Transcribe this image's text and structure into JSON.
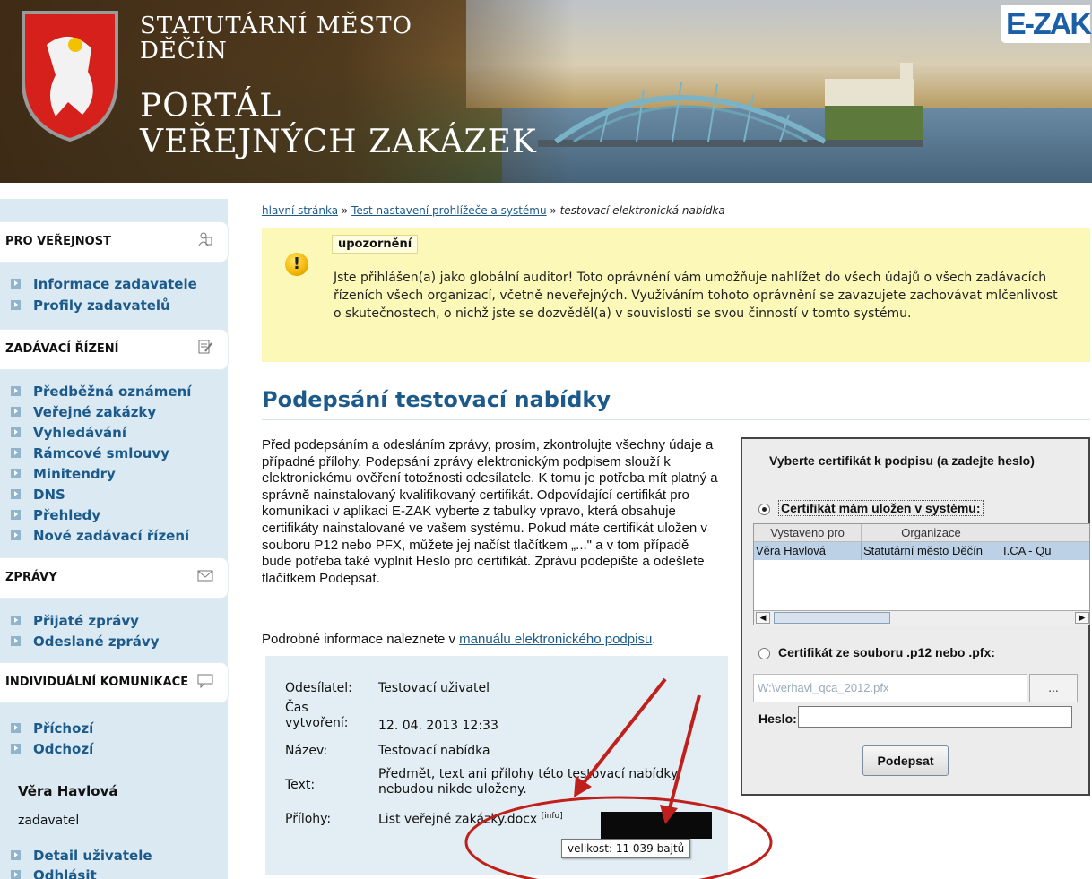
{
  "header": {
    "city_line1": "STATUTÁRNÍ MĚSTO",
    "city_line2": "DĚČÍN",
    "portal_line1": "PORTÁL",
    "portal_line2": "VEŘEJNÝCH ZAKÁZEK",
    "logo": "E-ZAK",
    "brand_color": "#1b5fa6"
  },
  "sidebar": {
    "sections": [
      {
        "label": "PRO VEŘEJNOST",
        "icon": "people-icon",
        "items": [
          "Informace zadavatele",
          "Profily zadavatelů"
        ]
      },
      {
        "label": "ZADÁVACÍ ŘÍZENÍ",
        "icon": "edit-document-icon",
        "items": [
          "Předběžná oznámení",
          "Veřejné zakázky",
          "Vyhledávání",
          "Rámcové smlouvy",
          "Minitendry",
          "DNS",
          "Přehledy",
          "Nové zadávací řízení"
        ]
      },
      {
        "label": "ZPRÁVY",
        "icon": "envelope-icon",
        "items": [
          "Přijaté zprávy",
          "Odeslané zprávy"
        ]
      },
      {
        "label": "INDIVIDUÁLNÍ KOMUNIKACE",
        "icon": "speech-bubble-icon",
        "items": [
          "Příchozí",
          "Odchozí"
        ]
      }
    ],
    "user": {
      "name": "Věra Havlová",
      "role": "zadavatel",
      "links": [
        "Detail uživatele",
        "Odhlásit"
      ]
    }
  },
  "breadcrumb": {
    "home": "hlavní stránka",
    "sep": "»",
    "level2": "Test nastavení prohlížeče a systému",
    "current": "testovací elektronická nabídka"
  },
  "warning": {
    "tag": "upozornění",
    "icon": "exclamation-icon",
    "text": "Jste přihlášen(a) jako globální auditor! Toto oprávnění vám umožňuje nahlížet do všech údajů o všech zadávacích řízeních všech organizací, včetně neveřejných. Využíváním tohoto oprávnění se zavazujete zachovávat mlčenlivost o skutečnostech, o nichž jste se dozvěděl(a) v souvislosti se svou činností v tomto systému."
  },
  "main": {
    "title": "Podepsání testovací nabídky",
    "description": "Před podepsáním a odesláním zprávy, prosím, zkontrolujte všechny údaje a případné přílohy. Podepsání zprávy elektronickým podpisem slouží k elektronickému ověření totožnosti odesílatele. K tomu je potřeba mít platný a správně nainstalovaný kvalifikovaný certifikát. Odpovídající certifikát pro komunikaci v aplikaci E-ZAK vyberte z tabulky vpravo, která obsahuje certifikáty nainstalované ve vašem systému. Pokud máte certifikát uložen v souboru P12 nebo PFX, můžete jej načíst tlačítkem „...\" a v tom případě bude potřeba také vyplnit Heslo pro certifikát. Zprávu podepište a odešlete tlačítkem Podepsat.",
    "more_prefix": "Podrobné informace naleznete v ",
    "more_link": "manuálu elektronického podpisu",
    "more_suffix": "."
  },
  "details": {
    "sender_label": "Odesílatel:",
    "sender_value": "Testovací uživatel",
    "created_label": "Čas vytvoření:",
    "created_value": "12. 04. 2013 12:33",
    "name_label": "Název:",
    "name_value": "Testovací nabídka",
    "text_label": "Text:",
    "text_value": "Předmět, text ani přílohy této testovací nabídky nebudou nikde uloženy.",
    "attach_label": "Přílohy:",
    "attach_value": "List veřejné zakázky.docx",
    "attach_info": "[info]",
    "tooltip": "velikost: 11 039 bajtů"
  },
  "applet": {
    "title": "Vyberte certifikát k podpisu (a zadejte heslo)",
    "option_system": "Certifikát mám uložen v systému:",
    "columns": [
      "Vystaveno pro",
      "Organizace",
      ""
    ],
    "rows": [
      [
        "Věra Havlová",
        "Statutární město Děčín",
        "I.CA - Qu"
      ]
    ],
    "option_file": "Certifikát ze souboru .p12 nebo .pfx:",
    "file_value": "W:\\verhavl_qca_2012.pfx",
    "browse_label": "...",
    "password_label": "Heslo:",
    "sign_label": "Podepsat"
  },
  "colors": {
    "link": "#1b5a8a",
    "sidebar_bg": "#dbe9f2",
    "warning_bg": "#fbf8b8",
    "annotation_red": "#c0201b"
  }
}
